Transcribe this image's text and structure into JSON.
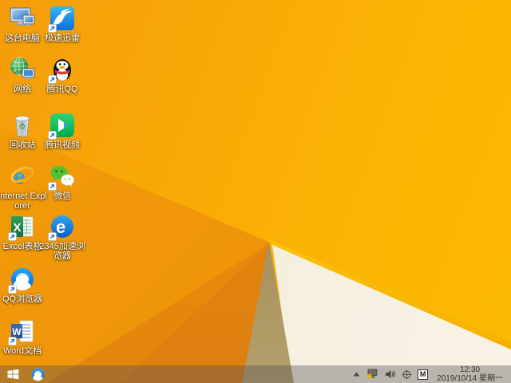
{
  "wallpaper": {
    "theme": "windows-8.1-orange-polygon",
    "colors": {
      "base_orange": "#f8a906",
      "bright_orange": "#fcba03",
      "dark_orange_facet": "#e5880c",
      "cream_triangle": "#f4eedd",
      "olive_wedge": "#a08a55",
      "edge_highlight": "#fec40d"
    }
  },
  "desktop": {
    "icons": [
      {
        "name": "this-pc",
        "label": "这台电脑",
        "shortcut": false
      },
      {
        "name": "xunlei-speed",
        "label": "极速迅雷",
        "shortcut": true
      },
      {
        "name": "network",
        "label": "网络",
        "shortcut": false
      },
      {
        "name": "tencent-qq",
        "label": "腾讯QQ",
        "shortcut": true
      },
      {
        "name": "recycle-bin",
        "label": "回收站",
        "shortcut": false
      },
      {
        "name": "tencent-video",
        "label": "腾讯视频",
        "shortcut": true
      },
      {
        "name": "internet-explorer",
        "label": "Internet Explorer",
        "shortcut": false
      },
      {
        "name": "wechat",
        "label": "微信",
        "shortcut": true
      },
      {
        "name": "excel",
        "label": "Excel表格",
        "shortcut": true
      },
      {
        "name": "browser-2345",
        "label": "2345加速浏览器",
        "shortcut": true
      },
      {
        "name": "qq-browser",
        "label": "QQ浏览器",
        "shortcut": true
      },
      {
        "name": "word",
        "label": "Word文档",
        "shortcut": true
      }
    ]
  },
  "taskbar": {
    "pinned": [
      "start",
      "qq-browser"
    ],
    "tray": {
      "icons": [
        "hidden-icons-chevron",
        "network-status-warning",
        "volume",
        "target",
        "input-method"
      ],
      "input_label": "M"
    },
    "clock": {
      "time": "12:30",
      "date": "2019/10/14 星期一"
    }
  }
}
